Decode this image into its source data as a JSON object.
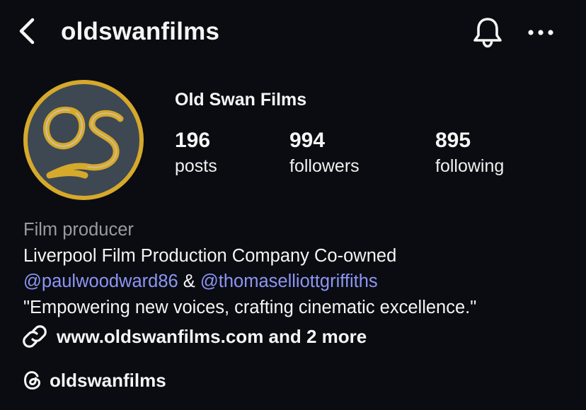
{
  "header": {
    "username": "oldswanfilms",
    "back_icon": "chevron-left-icon",
    "bell_icon": "bell-icon",
    "more_icon": "ellipsis-icon"
  },
  "profile": {
    "display_name": "Old Swan Films",
    "avatar_monogram": "os",
    "stats": [
      {
        "value": "196",
        "label": "posts"
      },
      {
        "value": "994",
        "label": "followers"
      },
      {
        "value": "895",
        "label": "following"
      }
    ]
  },
  "bio": {
    "category": "Film producer",
    "line1": "Liverpool Film Production Company Co-owned",
    "mention1": "@paulwoodward86",
    "connector": " & ",
    "mention2": "@thomaselliottgriffiths",
    "quote": "\"Empowering new voices, crafting cinematic excellence.\""
  },
  "links": {
    "icon": "link-icon",
    "text": "www.oldswanfilms.com and 2 more"
  },
  "threads": {
    "icon": "threads-icon",
    "text": "oldswanfilms"
  },
  "colors": {
    "background": "#0b0c11",
    "text": "#f5f5f5",
    "muted": "#9a9a9f",
    "mention": "#8c96f5",
    "avatar_ring": "#d6a92b",
    "avatar_bg": "#3d4853"
  }
}
